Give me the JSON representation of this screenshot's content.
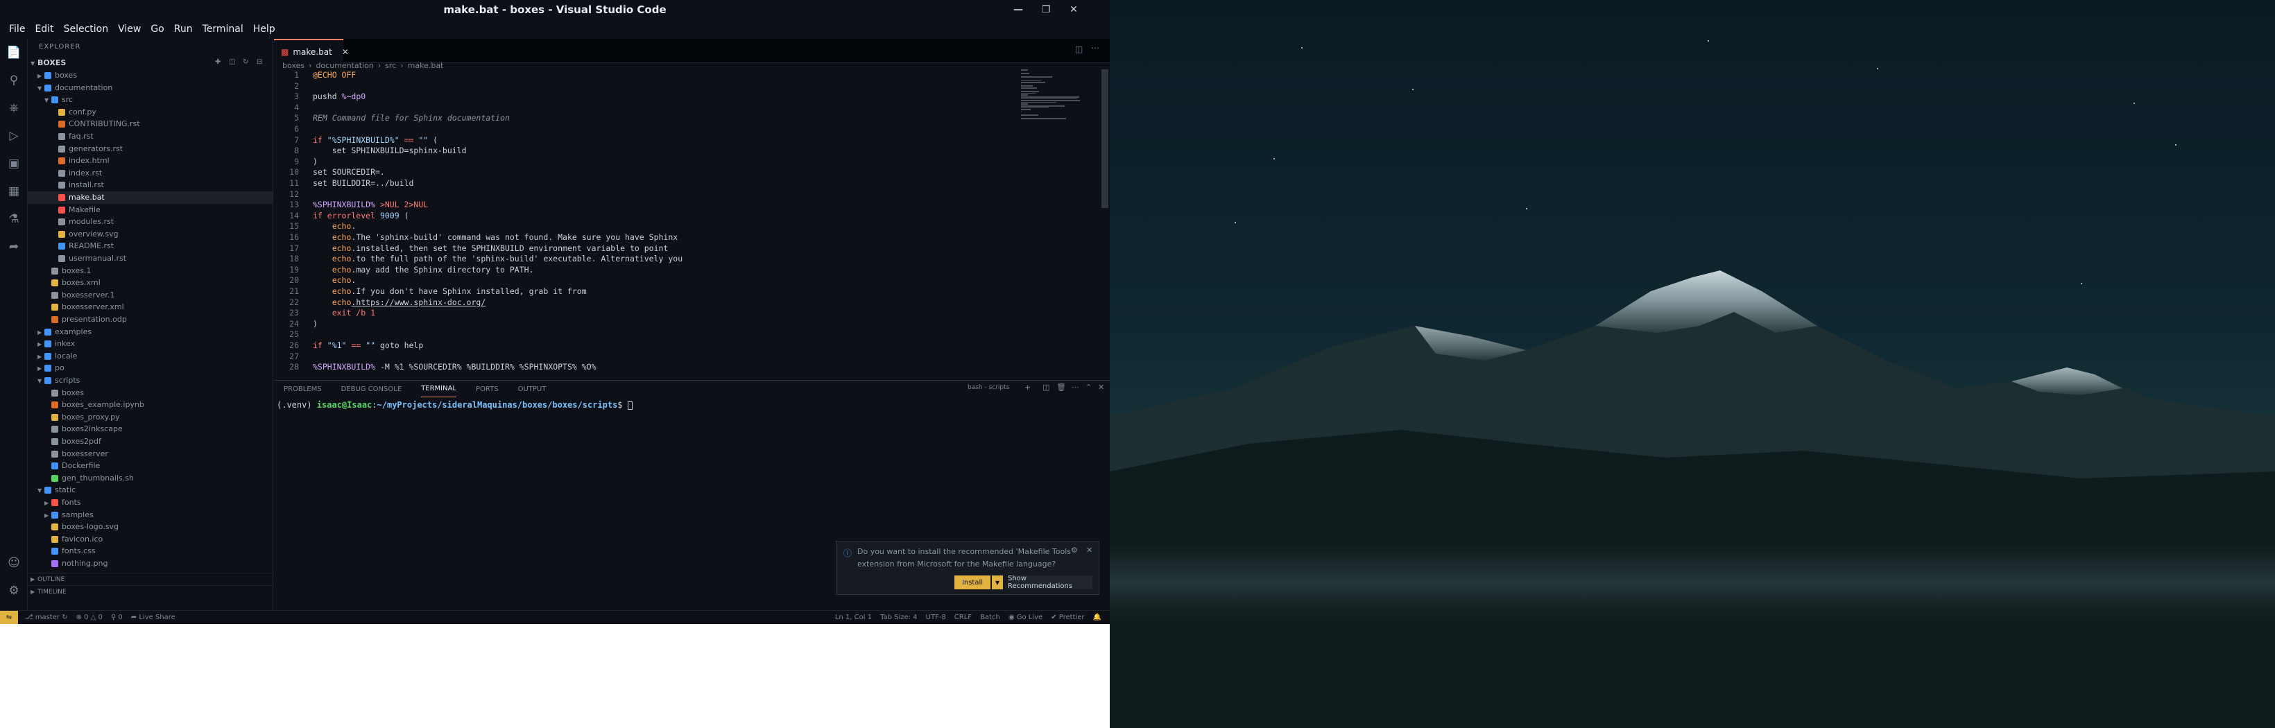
{
  "window": {
    "title": "make.bat - boxes - Visual Studio Code"
  },
  "menu": [
    "File",
    "Edit",
    "Selection",
    "View",
    "Go",
    "Run",
    "Terminal",
    "Help"
  ],
  "sidebar": {
    "header": "EXPLORER",
    "root": "BOXES",
    "items": [
      {
        "label": "boxes",
        "kind": "folder",
        "depth": 1,
        "color": "#4493f8"
      },
      {
        "label": "documentation",
        "kind": "folder-open",
        "depth": 1,
        "color": "#4493f8"
      },
      {
        "label": "src",
        "kind": "folder-open",
        "depth": 2,
        "color": "#4493f8"
      },
      {
        "label": "conf.py",
        "kind": "file",
        "depth": 3,
        "color": "#e3b341"
      },
      {
        "label": "CONTRIBUTING.rst",
        "kind": "file",
        "depth": 3,
        "color": "#db6d28"
      },
      {
        "label": "faq.rst",
        "kind": "file",
        "depth": 3,
        "color": "#8b949e"
      },
      {
        "label": "generators.rst",
        "kind": "file",
        "depth": 3,
        "color": "#8b949e"
      },
      {
        "label": "index.html",
        "kind": "file",
        "depth": 3,
        "color": "#db6d28"
      },
      {
        "label": "index.rst",
        "kind": "file",
        "depth": 3,
        "color": "#8b949e"
      },
      {
        "label": "install.rst",
        "kind": "file",
        "depth": 3,
        "color": "#8b949e"
      },
      {
        "label": "make.bat",
        "kind": "file",
        "depth": 3,
        "color": "#f85149",
        "active": true
      },
      {
        "label": "Makefile",
        "kind": "file",
        "depth": 3,
        "color": "#f85149"
      },
      {
        "label": "modules.rst",
        "kind": "file",
        "depth": 3,
        "color": "#8b949e"
      },
      {
        "label": "overview.svg",
        "kind": "file",
        "depth": 3,
        "color": "#e3b341"
      },
      {
        "label": "README.rst",
        "kind": "file",
        "depth": 3,
        "color": "#4493f8"
      },
      {
        "label": "usermanual.rst",
        "kind": "file",
        "depth": 3,
        "color": "#8b949e"
      },
      {
        "label": "boxes.1",
        "kind": "file",
        "depth": 2,
        "color": "#8b949e"
      },
      {
        "label": "boxes.xml",
        "kind": "file",
        "depth": 2,
        "color": "#e3b341"
      },
      {
        "label": "boxesserver.1",
        "kind": "file",
        "depth": 2,
        "color": "#8b949e"
      },
      {
        "label": "boxesserver.xml",
        "kind": "file",
        "depth": 2,
        "color": "#e3b341"
      },
      {
        "label": "presentation.odp",
        "kind": "file",
        "depth": 2,
        "color": "#db6d28"
      },
      {
        "label": "examples",
        "kind": "folder",
        "depth": 1,
        "color": "#4493f8"
      },
      {
        "label": "inkex",
        "kind": "folder",
        "depth": 1,
        "color": "#4493f8"
      },
      {
        "label": "locale",
        "kind": "folder",
        "depth": 1,
        "color": "#4493f8"
      },
      {
        "label": "po",
        "kind": "folder",
        "depth": 1,
        "color": "#4493f8"
      },
      {
        "label": "scripts",
        "kind": "folder-open",
        "depth": 1,
        "color": "#4493f8"
      },
      {
        "label": "boxes",
        "kind": "file",
        "depth": 2,
        "color": "#8b949e"
      },
      {
        "label": "boxes_example.ipynb",
        "kind": "file",
        "depth": 2,
        "color": "#db6d28"
      },
      {
        "label": "boxes_proxy.py",
        "kind": "file",
        "depth": 2,
        "color": "#e3b341"
      },
      {
        "label": "boxes2inkscape",
        "kind": "file",
        "depth": 2,
        "color": "#8b949e"
      },
      {
        "label": "boxes2pdf",
        "kind": "file",
        "depth": 2,
        "color": "#8b949e"
      },
      {
        "label": "boxesserver",
        "kind": "file",
        "depth": 2,
        "color": "#8b949e"
      },
      {
        "label": "Dockerfile",
        "kind": "file",
        "depth": 2,
        "color": "#4493f8"
      },
      {
        "label": "gen_thumbnails.sh",
        "kind": "file",
        "depth": 2,
        "color": "#56d364"
      },
      {
        "label": "static",
        "kind": "folder-open",
        "depth": 1,
        "color": "#4493f8"
      },
      {
        "label": "fonts",
        "kind": "folder",
        "depth": 2,
        "color": "#f85149"
      },
      {
        "label": "samples",
        "kind": "folder",
        "depth": 2,
        "color": "#4493f8"
      },
      {
        "label": "boxes-logo.svg",
        "kind": "file",
        "depth": 2,
        "color": "#e3b341"
      },
      {
        "label": "favicon.ico",
        "kind": "file",
        "depth": 2,
        "color": "#e3b341"
      },
      {
        "label": "fonts.css",
        "kind": "file",
        "depth": 2,
        "color": "#4493f8"
      },
      {
        "label": "nothing.png",
        "kind": "file",
        "depth": 2,
        "color": "#a371f7"
      }
    ],
    "outline": "OUTLINE",
    "timeline": "TIMELINE"
  },
  "editor": {
    "tab_label": "make.bat",
    "breadcrumb": [
      "boxes",
      "documentation",
      "src",
      "make.bat"
    ],
    "lines": [
      [
        {
          "t": "@ECHO OFF",
          "c": "ec"
        }
      ],
      [],
      [
        {
          "t": "pushd ",
          "c": "pl"
        },
        {
          "t": "%~dp0",
          "c": "var"
        }
      ],
      [],
      [
        {
          "t": "REM Command file for Sphinx documentation",
          "c": "cm"
        }
      ],
      [],
      [
        {
          "t": "if ",
          "c": "kw"
        },
        {
          "t": "\"%SPHINXBUILD%\"",
          "c": "str"
        },
        {
          "t": " == ",
          "c": "kw"
        },
        {
          "t": "\"\"",
          "c": "str"
        },
        {
          "t": " (",
          "c": "pl"
        }
      ],
      [
        {
          "t": "    set SPHINXBUILD=sphinx-build",
          "c": "pl"
        }
      ],
      [
        {
          "t": ")",
          "c": "pl"
        }
      ],
      [
        {
          "t": "set SOURCEDIR=.",
          "c": "pl"
        }
      ],
      [
        {
          "t": "set BUILDDIR=../build",
          "c": "pl"
        }
      ],
      [],
      [
        {
          "t": "%SPHINXBUILD%",
          "c": "var"
        },
        {
          "t": " >NUL 2>NUL",
          "c": "kw"
        }
      ],
      [
        {
          "t": "if errorlevel ",
          "c": "kw"
        },
        {
          "t": "9009",
          "c": "str"
        },
        {
          "t": " (",
          "c": "pl"
        }
      ],
      [
        {
          "t": "    echo",
          "c": "ec"
        },
        {
          "t": ".",
          "c": "pl"
        }
      ],
      [
        {
          "t": "    echo",
          "c": "ec"
        },
        {
          "t": ".The 'sphinx-build' command was not found. Make sure you have Sphinx",
          "c": "pl"
        }
      ],
      [
        {
          "t": "    echo",
          "c": "ec"
        },
        {
          "t": ".installed, then set the SPHINXBUILD environment variable to point",
          "c": "pl"
        }
      ],
      [
        {
          "t": "    echo",
          "c": "ec"
        },
        {
          "t": ".to the full path of the 'sphinx-build' executable. Alternatively you",
          "c": "pl"
        }
      ],
      [
        {
          "t": "    echo",
          "c": "ec"
        },
        {
          "t": ".may add the Sphinx directory to PATH.",
          "c": "pl"
        }
      ],
      [
        {
          "t": "    echo",
          "c": "ec"
        },
        {
          "t": ".",
          "c": "pl"
        }
      ],
      [
        {
          "t": "    echo",
          "c": "ec"
        },
        {
          "t": ".If you don't have Sphinx installed, grab it from",
          "c": "pl"
        }
      ],
      [
        {
          "t": "    echo",
          "c": "ec"
        },
        {
          "t": ".https://www.sphinx-doc.org/",
          "c": "pl"
        }
      ],
      [
        {
          "t": "    exit /b 1",
          "c": "kw"
        }
      ],
      [
        {
          "t": ")",
          "c": "pl"
        }
      ],
      [],
      [
        {
          "t": "if ",
          "c": "kw"
        },
        {
          "t": "\"%1\"",
          "c": "str"
        },
        {
          "t": " == ",
          "c": "kw"
        },
        {
          "t": "\"\"",
          "c": "str"
        },
        {
          "t": " goto help",
          "c": "pl"
        }
      ],
      [],
      [
        {
          "t": "%SPHINXBUILD%",
          "c": "var"
        },
        {
          "t": " -M %1 %SOURCEDIR% %BUILDDIR% %SPHINXOPTS% %O%",
          "c": "pl"
        }
      ]
    ]
  },
  "panel": {
    "tabs": [
      "PROBLEMS",
      "DEBUG CONSOLE",
      "TERMINAL",
      "PORTS",
      "OUTPUT"
    ],
    "active_tab": "TERMINAL",
    "term_label": "bash - scripts",
    "prompt_venv": "(.venv) ",
    "prompt_user": "isaac@Isaac",
    "prompt_sep": ":",
    "prompt_path": "~/myProjects/sideralMaquinas/boxes/boxes/scripts",
    "prompt_end": "$ "
  },
  "notification": {
    "message_line1": "Do you want to install the recommended 'Makefile Tools'",
    "message_line2": "extension from Microsoft for the Makefile language?",
    "install_label": "Install",
    "show_label": "Show Recommendations"
  },
  "statusbar": {
    "branch": "master",
    "problems": "0 △ 0",
    "ports": "0",
    "live_share": "Live Share",
    "position": "Ln 1, Col 1",
    "tab_size": "Tab Size: 4",
    "encoding": "UTF-8",
    "eol": "CRLF",
    "language": "Batch",
    "go_live": "Go Live",
    "prettier": "Prettier"
  }
}
